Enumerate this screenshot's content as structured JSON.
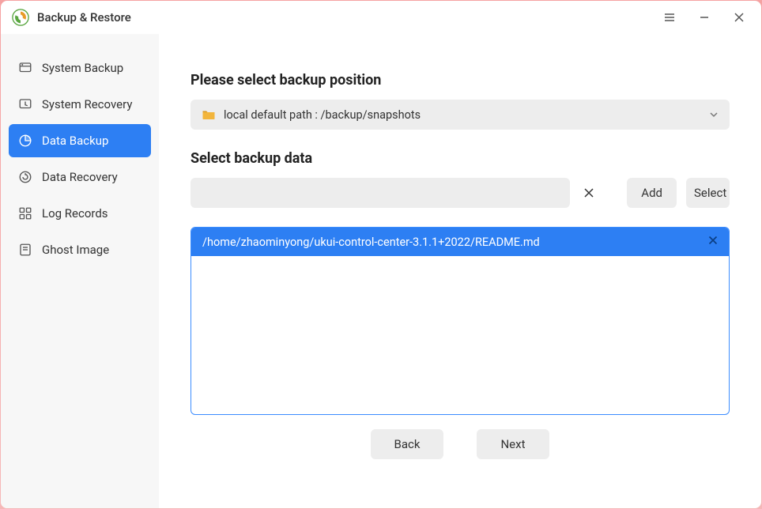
{
  "title": "Backup & Restore",
  "sidebar": {
    "items": [
      {
        "label": "System Backup"
      },
      {
        "label": "System Recovery"
      },
      {
        "label": "Data Backup"
      },
      {
        "label": "Data Recovery"
      },
      {
        "label": "Log Records"
      },
      {
        "label": "Ghost Image"
      }
    ]
  },
  "main": {
    "section1_title": "Please select backup position",
    "path_dropdown": "local default path : /backup/snapshots",
    "section2_title": "Select backup data",
    "path_input_value": "",
    "add_label": "Add",
    "select_label": "Select",
    "file_list": [
      {
        "path": "/home/zhaominyong/ukui-control-center-3.1.1+2022/README.md"
      }
    ],
    "back_label": "Back",
    "next_label": "Next"
  }
}
